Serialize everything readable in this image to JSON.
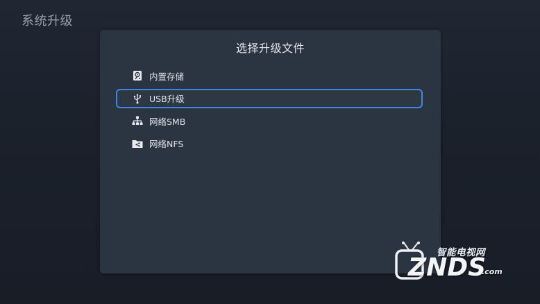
{
  "page": {
    "title": "系统升级"
  },
  "dialog": {
    "title": "选择升级文件",
    "options": [
      {
        "label": "内置存储",
        "icon": "internal-storage-icon"
      },
      {
        "label": "USB升级",
        "icon": "usb-icon",
        "focused": true
      },
      {
        "label": "网络SMB",
        "icon": "network-tree-icon"
      },
      {
        "label": "网络NFS",
        "icon": "network-folder-icon"
      }
    ]
  },
  "watermark": {
    "cn_text": "智能电视网",
    "brand": "ZNDS",
    "domain_suffix": ".com"
  },
  "colors": {
    "background": "#1d232d",
    "dialog": "#2b3541",
    "focus_border": "#3d86ea",
    "text": "#dfe3e8",
    "page_title": "#9aa1ab"
  }
}
